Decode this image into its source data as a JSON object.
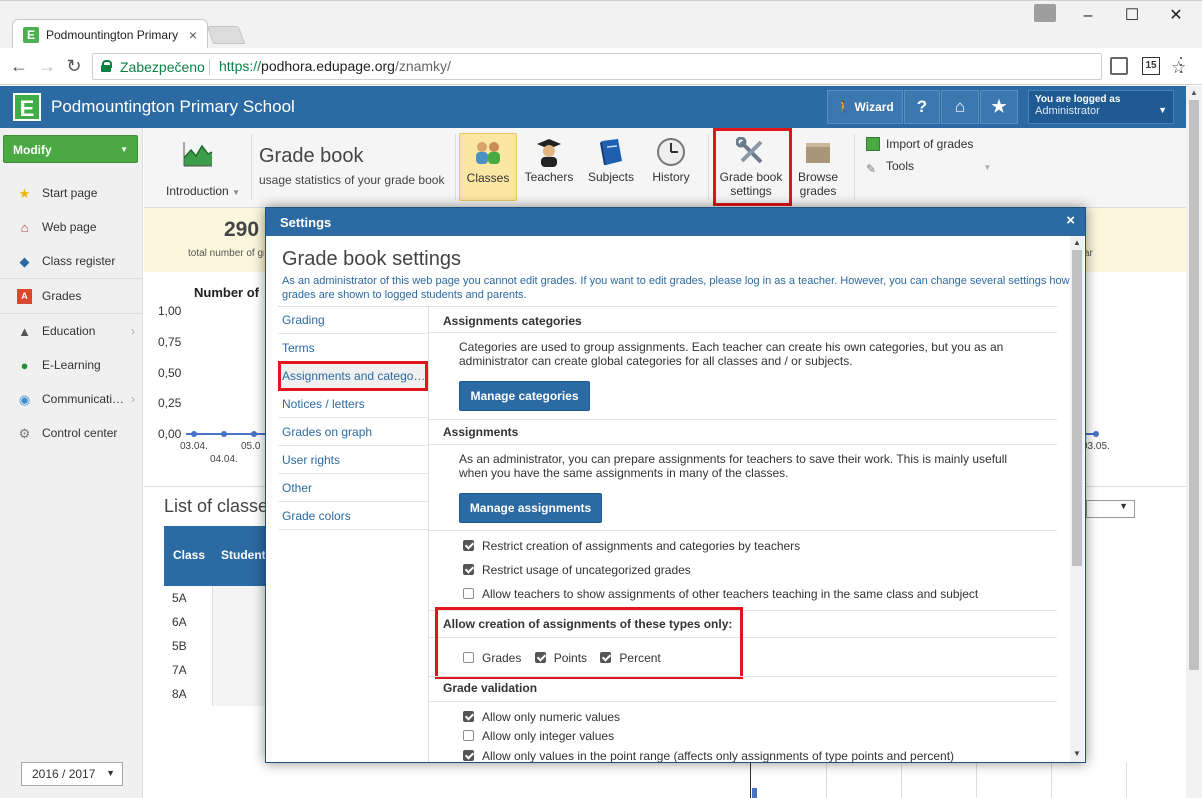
{
  "browser": {
    "tab_title": "Podmountington Primary",
    "secure_label": "Zabezpečeno",
    "url_protocol": "https://",
    "url_host": "podhora.edupage.org",
    "url_path": "/znamky/",
    "ext_badge": "15"
  },
  "header": {
    "logo_letter": "E",
    "school_name": "Podmountington Primary School",
    "wizard_label": "Wizard",
    "help_label": "?",
    "logged_as_label": "You are logged as",
    "user_name": "Administrator"
  },
  "sidebar": {
    "modify_label": "Modify",
    "items": [
      {
        "label": "Start page"
      },
      {
        "label": "Web page"
      },
      {
        "label": "Class register"
      },
      {
        "label": "Grades"
      },
      {
        "label": "Education"
      },
      {
        "label": "E-Learning"
      },
      {
        "label": "Communicati…"
      },
      {
        "label": "Control center"
      }
    ],
    "year": "2016 / 2017"
  },
  "ribbon": {
    "intro_label": "Introduction",
    "title": "Grade book",
    "subtitle": "usage statistics of your grade book",
    "buttons": [
      {
        "label": "Classes"
      },
      {
        "label": "Teachers"
      },
      {
        "label": "Subjects"
      },
      {
        "label": "History"
      },
      {
        "label": "Grade book settings"
      },
      {
        "label": "Browse grades"
      }
    ],
    "import_label": "Import of grades",
    "tools_label": "Tools"
  },
  "background": {
    "stat_value": "290",
    "stat_label": "total number of grades",
    "stat_right_label": "ar",
    "chart_title": "Number of",
    "y_ticks": [
      "1,00",
      "0,75",
      "0,50",
      "0,25",
      "0,00"
    ],
    "x_ticks_left": [
      "03.04.",
      "04.04.",
      "05.0"
    ],
    "x_tick_right": "03.05.",
    "list_title": "List of classes",
    "col_class": "Class",
    "col_students": "Students",
    "classes": [
      "5A",
      "6A",
      "5B",
      "7A",
      "8A"
    ]
  },
  "modal": {
    "header": "Settings",
    "close": "×",
    "title": "Grade book settings",
    "description": "As an administrator of this web page you cannot edit grades. If you want to edit grades, please log in as a teacher. However, you can change several settings how grades are shown to logged students and parents.",
    "nav": [
      {
        "label": "Grading"
      },
      {
        "label": "Terms"
      },
      {
        "label": "Assignments and categories"
      },
      {
        "label": "Notices / letters"
      },
      {
        "label": "Grades on graph"
      },
      {
        "label": "User rights"
      },
      {
        "label": "Other"
      },
      {
        "label": "Grade colors"
      }
    ],
    "sec_categories": "Assignments categories",
    "categories_text": "Categories are used to group assignments. Each teacher can create his own categories, but you as an administrator can create global categories for all classes and / or subjects.",
    "manage_categories": "Manage categories",
    "sec_assignments": "Assignments",
    "assignments_text": "As an administrator, you can prepare assignments for teachers to save their work. This is mainly usefull when you have the same assignments in many of the classes.",
    "manage_assignments": "Manage assignments",
    "checks": [
      {
        "label": "Restrict creation of assignments and categories by teachers",
        "checked": true
      },
      {
        "label": "Restrict usage of uncategorized grades",
        "checked": true
      },
      {
        "label": "Allow teachers to show assignments of other teachers teaching in the same class and subject",
        "checked": false
      }
    ],
    "sec_types": "Allow creation of assignments of these types only:",
    "types": [
      {
        "label": "Grades",
        "checked": false
      },
      {
        "label": "Points",
        "checked": true
      },
      {
        "label": "Percent",
        "checked": true
      }
    ],
    "sec_validation": "Grade validation",
    "validation": [
      {
        "label": "Allow only numeric values",
        "checked": true
      },
      {
        "label": "Allow only integer values",
        "checked": false
      },
      {
        "label": "Allow only values in the point range (affects only assignments of type points and percent)",
        "checked": true
      }
    ]
  },
  "colors": {
    "brand_blue": "#2c6aa3",
    "green": "#4aa943",
    "highlight_red": "#e2141c"
  }
}
